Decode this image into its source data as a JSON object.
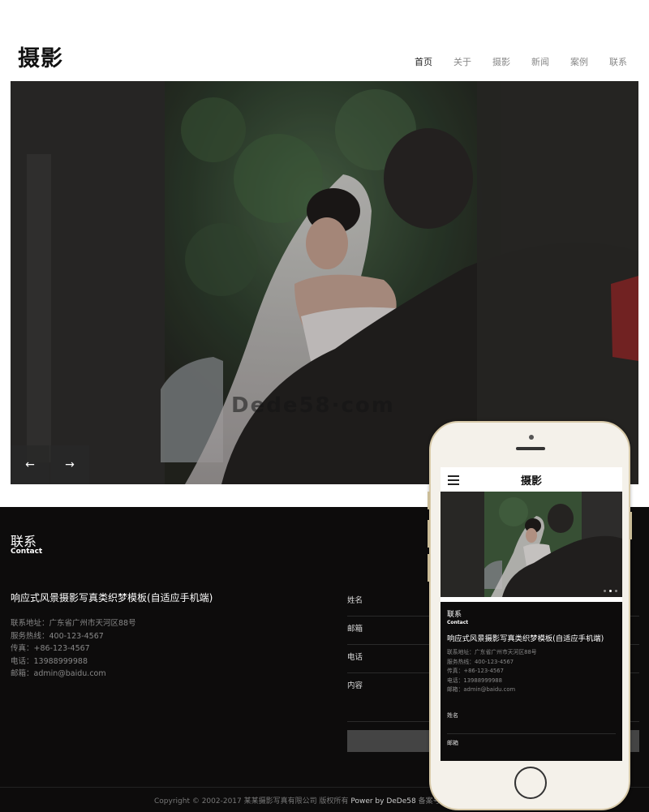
{
  "header": {
    "logo": "摄影",
    "nav": [
      {
        "label": "首页",
        "active": true
      },
      {
        "label": "关于",
        "active": false
      },
      {
        "label": "摄影",
        "active": false
      },
      {
        "label": "新闻",
        "active": false
      },
      {
        "label": "案例",
        "active": false
      },
      {
        "label": "联系",
        "active": false
      }
    ]
  },
  "banner": {
    "watermark": "Dede58·com",
    "prev_label": "←",
    "next_label": "→"
  },
  "contact": {
    "title": "联系",
    "subtitle": "Contact",
    "company": "响应式风景摄影写真类织梦模板(自适应手机端)",
    "info": [
      "联系地址：广东省广州市天河区88号",
      "服务热线：400-123-4567",
      "传真：+86-123-4567",
      "电话：13988999988",
      "邮箱：admin@baidu.com"
    ],
    "form": {
      "name_label": "姓名",
      "email_label": "邮箱",
      "phone_label": "电话",
      "content_label": "内容"
    }
  },
  "footer": {
    "copyright": "Copyright © 2002-2017 某某摄影写真有限公司 版权所有",
    "power": "Power by DeDe58",
    "icp": "备案号:"
  },
  "mobile": {
    "logo": "摄影",
    "title": "联系",
    "subtitle": "Contact",
    "company": "响应式风景摄影写真类织梦模板(自适应手机端)",
    "info": [
      "联系地址：广东省广州市天河区88号",
      "服务热线：400-123-4567",
      "传真：+86-123-4567",
      "电话：13988999988",
      "邮箱：admin@baidu.com"
    ],
    "name_label": "姓名",
    "email_label": "邮箱"
  },
  "colors": {
    "footer_bg": "#0d0c0c",
    "phone_frame": "#f4f1ea",
    "phone_trim": "#d7c9a8"
  }
}
